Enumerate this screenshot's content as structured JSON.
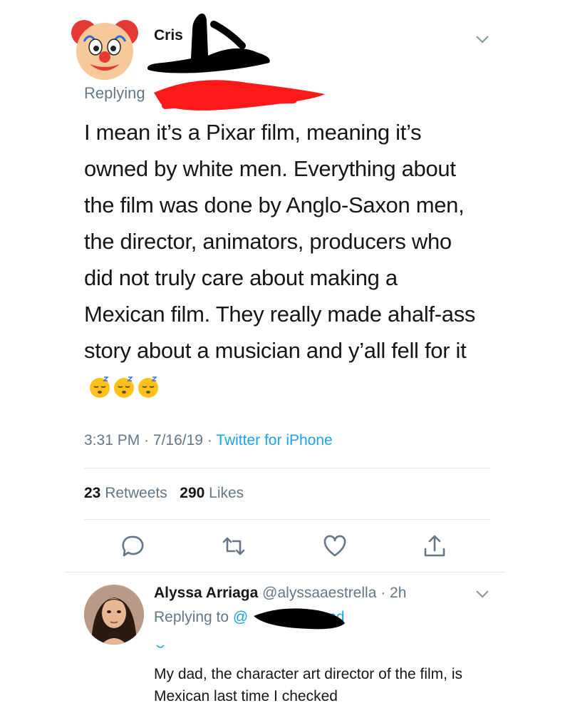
{
  "tweet": {
    "author_name": "Cris",
    "replying_label": "Replying",
    "body": "I mean it’s a Pixar film, meaning it’s owned by white men. Everything about the film was done by Anglo-Saxon men, the director, animators, producers who did not truly care about making a Mexican film. They really made ahalf-ass story about a musician and y’all fell for it",
    "emojis": [
      "sleeping-face-icon",
      "sleeping-face-icon",
      "sleeping-face-icon"
    ],
    "time": "3:31 PM",
    "date": "7/16/19",
    "client": "Twitter for iPhone",
    "retweets_count": "23",
    "retweets_label": "Retweets",
    "likes_count": "290",
    "likes_label": "Likes"
  },
  "reply": {
    "author_name": "Alyssa Arriaga",
    "handle": "@alyssaaestrella",
    "age": "2h",
    "replying_label": "Replying to",
    "mention_prefix": "@",
    "mention_suffix": "nd",
    "body": "My dad, the character art director of the film, is Mexican last time I checked"
  },
  "colors": {
    "link_blue": "#1da1f2",
    "muted_gray": "#657786",
    "divider": "#e1e8ed",
    "redaction_red": "#ff0000",
    "redaction_black": "#000000"
  }
}
